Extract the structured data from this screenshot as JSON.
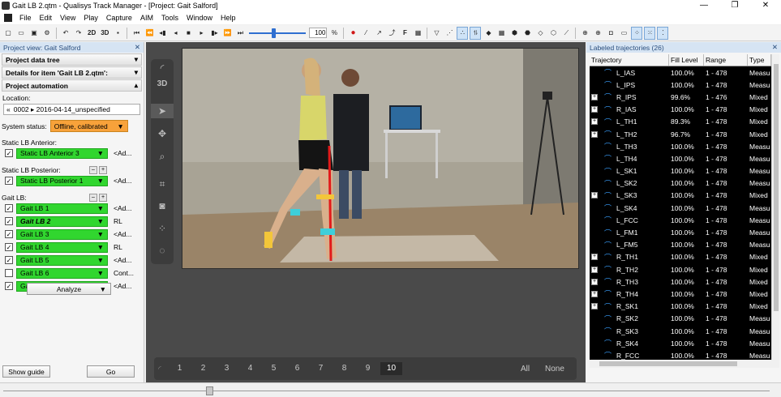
{
  "window": {
    "title": "Gait LB 2.qtm - Qualisys Track Manager - [Project: Gait Salford]"
  },
  "menu": [
    "File",
    "Edit",
    "View",
    "Play",
    "Capture",
    "AIM",
    "Tools",
    "Window",
    "Help"
  ],
  "toolbar": {
    "view2d": "2D",
    "view3d": "3D",
    "zoom": "100",
    "zoom_unit": "%",
    "f_label": "F"
  },
  "left_panel": {
    "header": "Project view: Gait Salford",
    "sections": [
      "Project data tree",
      "Details for item 'Gait LB 2.qtm':",
      "Project automation"
    ],
    "location_label": "Location:",
    "location_value": "0002  ▸ 2016-04-14_unspecified",
    "status_label": "System status:",
    "status_value": "Offline, calibrated",
    "anterior": {
      "label": "Static LB Anterior:",
      "item": "Static LB Anterior 3",
      "after": "<Ad..."
    },
    "posterior": {
      "label": "Static LB Posterior:",
      "item": "Static LB Posterior 1",
      "after": "<Ad..."
    },
    "gait": {
      "label": "Gait LB:",
      "items": [
        {
          "name": "Gait LB 1",
          "checked": true,
          "after": "<Ad..."
        },
        {
          "name": "Gait LB 2",
          "checked": true,
          "after": "RL"
        },
        {
          "name": "Gait LB 3",
          "checked": true,
          "after": "<Ad..."
        },
        {
          "name": "Gait LB 4",
          "checked": true,
          "after": "RL"
        },
        {
          "name": "Gait LB 5",
          "checked": true,
          "after": "<Ad..."
        },
        {
          "name": "Gait LB 6",
          "checked": false,
          "after": "Cont..."
        },
        {
          "name": "Gait LB 7",
          "checked": true,
          "after": "<Ad..."
        }
      ]
    },
    "analyze": "Analyze",
    "show_guide": "Show guide",
    "go": "Go"
  },
  "center": {
    "side_label": "3D",
    "timeline": [
      "1",
      "2",
      "3",
      "4",
      "5",
      "6",
      "7",
      "8",
      "9",
      "10"
    ],
    "timeline_active": "10",
    "all": "All",
    "none": "None"
  },
  "right_panel": {
    "header": "Labeled trajectories (26)",
    "columns": [
      "Trajectory",
      "Fill Level",
      "Range",
      "Type"
    ],
    "rows": [
      {
        "name": "L_IAS",
        "fill": "100.0%",
        "range": "1 - 478",
        "type": "Measu",
        "expand": false
      },
      {
        "name": "L_IPS",
        "fill": "100.0%",
        "range": "1 - 478",
        "type": "Measu",
        "expand": false
      },
      {
        "name": "R_IPS",
        "fill": "99.6%",
        "range": "1 - 476",
        "type": "Mixed",
        "expand": true
      },
      {
        "name": "R_IAS",
        "fill": "100.0%",
        "range": "1 - 478",
        "type": "Mixed",
        "expand": true
      },
      {
        "name": "L_TH1",
        "fill": "89.3%",
        "range": "1 - 478",
        "type": "Mixed",
        "expand": true
      },
      {
        "name": "L_TH2",
        "fill": "96.7%",
        "range": "1 - 478",
        "type": "Mixed",
        "expand": true
      },
      {
        "name": "L_TH3",
        "fill": "100.0%",
        "range": "1 - 478",
        "type": "Measu",
        "expand": false
      },
      {
        "name": "L_TH4",
        "fill": "100.0%",
        "range": "1 - 478",
        "type": "Measu",
        "expand": false
      },
      {
        "name": "L_SK1",
        "fill": "100.0%",
        "range": "1 - 478",
        "type": "Measu",
        "expand": false
      },
      {
        "name": "L_SK2",
        "fill": "100.0%",
        "range": "1 - 478",
        "type": "Measu",
        "expand": false
      },
      {
        "name": "L_SK3",
        "fill": "100.0%",
        "range": "1 - 478",
        "type": "Mixed",
        "expand": true
      },
      {
        "name": "L_SK4",
        "fill": "100.0%",
        "range": "1 - 478",
        "type": "Measu",
        "expand": false
      },
      {
        "name": "L_FCC",
        "fill": "100.0%",
        "range": "1 - 478",
        "type": "Measu",
        "expand": false
      },
      {
        "name": "L_FM1",
        "fill": "100.0%",
        "range": "1 - 478",
        "type": "Measu",
        "expand": false
      },
      {
        "name": "L_FM5",
        "fill": "100.0%",
        "range": "1 - 478",
        "type": "Measu",
        "expand": false
      },
      {
        "name": "R_TH1",
        "fill": "100.0%",
        "range": "1 - 478",
        "type": "Mixed",
        "expand": true
      },
      {
        "name": "R_TH2",
        "fill": "100.0%",
        "range": "1 - 478",
        "type": "Mixed",
        "expand": true
      },
      {
        "name": "R_TH3",
        "fill": "100.0%",
        "range": "1 - 478",
        "type": "Mixed",
        "expand": true
      },
      {
        "name": "R_TH4",
        "fill": "100.0%",
        "range": "1 - 478",
        "type": "Mixed",
        "expand": true
      },
      {
        "name": "R_SK1",
        "fill": "100.0%",
        "range": "1 - 478",
        "type": "Mixed",
        "expand": true
      },
      {
        "name": "R_SK2",
        "fill": "100.0%",
        "range": "1 - 478",
        "type": "Measu",
        "expand": false
      },
      {
        "name": "R_SK3",
        "fill": "100.0%",
        "range": "1 - 478",
        "type": "Measu",
        "expand": false
      },
      {
        "name": "R_SK4",
        "fill": "100.0%",
        "range": "1 - 478",
        "type": "Measu",
        "expand": false
      },
      {
        "name": "R_FCC",
        "fill": "100.0%",
        "range": "1 - 478",
        "type": "Measu",
        "expand": false
      }
    ]
  }
}
